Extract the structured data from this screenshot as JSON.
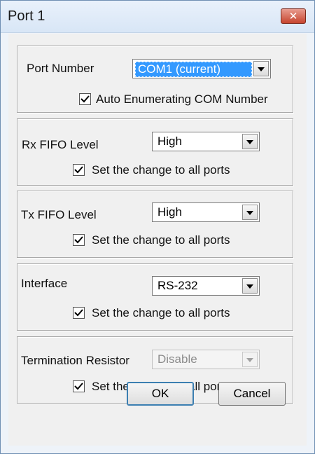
{
  "window": {
    "title": "Port 1",
    "close_glyph": "✕"
  },
  "port_group": {
    "label": "Port Number",
    "combo_value": "COM1 (current)",
    "checkbox_label": "Auto Enumerating COM Number",
    "checked": true
  },
  "rx_group": {
    "label": "Rx FIFO Level",
    "combo_value": "High",
    "checkbox_label": "Set the change to all ports",
    "checked": true
  },
  "tx_group": {
    "label": "Tx FIFO Level",
    "combo_value": "High",
    "checkbox_label": "Set the change to all ports",
    "checked": true
  },
  "interface_group": {
    "label": "Interface",
    "combo_value": "RS-232",
    "checkbox_label": "Set the change to all ports",
    "checked": true
  },
  "termination_group": {
    "label": "Termination Resistor",
    "combo_value": "Disable",
    "combo_disabled": true,
    "checkbox_label": "Set the change to all ports",
    "checked": true
  },
  "buttons": {
    "ok": "OK",
    "cancel": "Cancel"
  },
  "colors": {
    "selection": "#3399ff",
    "close_button": "#c6452f",
    "frame": "#6f8fb3"
  }
}
